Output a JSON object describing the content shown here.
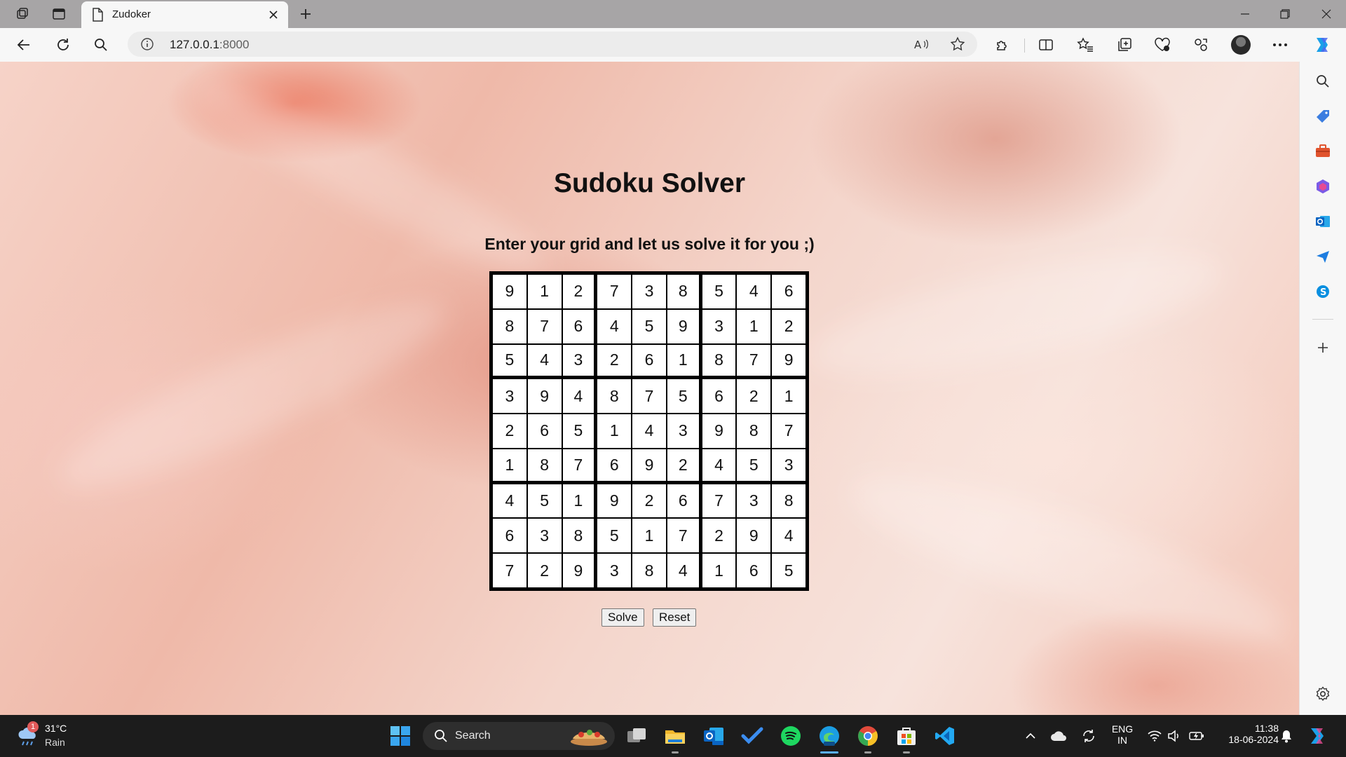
{
  "browser": {
    "tab_title": "Zudoker",
    "url_host": "127.0.0.1",
    "url_port": ":8000"
  },
  "page": {
    "title": "Sudoku Solver",
    "subtitle": "Enter your grid and let us solve it for you ;)",
    "grid": [
      [
        9,
        1,
        2,
        7,
        3,
        8,
        5,
        4,
        6
      ],
      [
        8,
        7,
        6,
        4,
        5,
        9,
        3,
        1,
        2
      ],
      [
        5,
        4,
        3,
        2,
        6,
        1,
        8,
        7,
        9
      ],
      [
        3,
        9,
        4,
        8,
        7,
        5,
        6,
        2,
        1
      ],
      [
        2,
        6,
        5,
        1,
        4,
        3,
        9,
        8,
        7
      ],
      [
        1,
        8,
        7,
        6,
        9,
        2,
        4,
        5,
        3
      ],
      [
        4,
        5,
        1,
        9,
        2,
        6,
        7,
        3,
        8
      ],
      [
        6,
        3,
        8,
        5,
        1,
        7,
        2,
        9,
        4
      ],
      [
        7,
        2,
        9,
        3,
        8,
        4,
        1,
        6,
        5
      ]
    ],
    "solve_label": "Solve",
    "reset_label": "Reset"
  },
  "taskbar": {
    "weather_badge": "1",
    "weather_temp": "31°C",
    "weather_desc": "Rain",
    "search_label": "Search",
    "lang_top": "ENG",
    "lang_bottom": "IN",
    "time": "11:38",
    "date": "18-06-2024"
  },
  "colors": {
    "accent_blue": "#0078d4",
    "background_peach": "#f4d6cc"
  }
}
